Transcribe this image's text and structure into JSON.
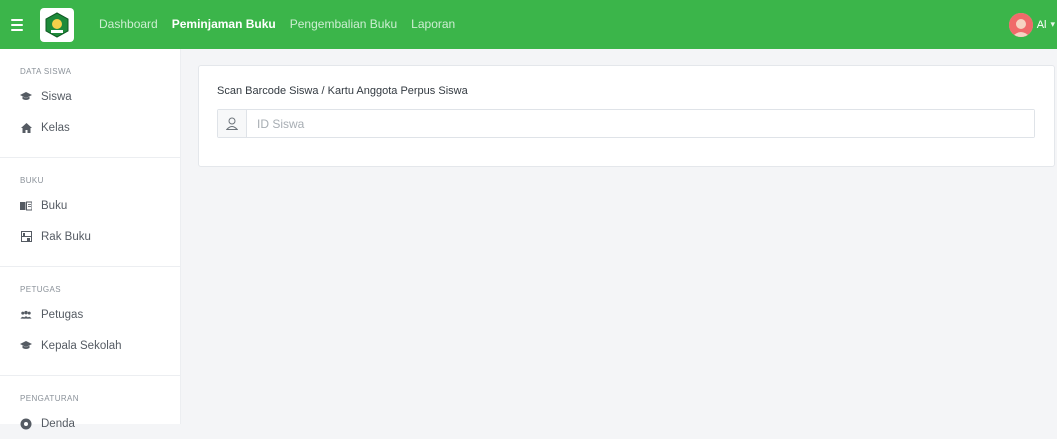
{
  "navbar": {
    "links": [
      {
        "label": "Dashboard",
        "active": false
      },
      {
        "label": "Peminjaman Buku",
        "active": true
      },
      {
        "label": "Pengembalian Buku",
        "active": false
      },
      {
        "label": "Laporan",
        "active": false
      }
    ],
    "user_name": "Al",
    "icons": {
      "menu": "hamburger-icon",
      "logo": "school-logo",
      "avatar": "user-avatar",
      "caret": "chevron-down-icon"
    },
    "bg_color": "#3bb54a"
  },
  "sidebar": {
    "sections": [
      {
        "title": "DATA SISWA",
        "items": [
          {
            "label": "Siswa",
            "icon": "graduation-cap-icon"
          },
          {
            "label": "Kelas",
            "icon": "home-icon"
          }
        ]
      },
      {
        "title": "BUKU",
        "items": [
          {
            "label": "Buku",
            "icon": "book-open-icon"
          },
          {
            "label": "Rak Buku",
            "icon": "shelf-icon"
          }
        ]
      },
      {
        "title": "PETUGAS",
        "items": [
          {
            "label": "Petugas",
            "icon": "users-icon"
          },
          {
            "label": "Kepala Sekolah",
            "icon": "graduation-cap-icon"
          }
        ]
      },
      {
        "title": "PENGATURAN",
        "items": [
          {
            "label": "Denda",
            "icon": "settings-icon"
          }
        ]
      }
    ]
  },
  "main": {
    "scan_label": "Scan Barcode Siswa / Kartu Anggota Perpus Siswa",
    "id_input": {
      "placeholder": "ID Siswa",
      "value": "",
      "icon": "user-icon"
    }
  }
}
